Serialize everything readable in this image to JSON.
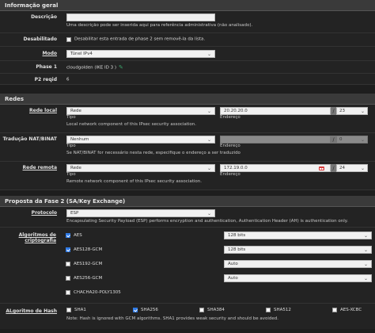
{
  "general": {
    "title": "Informação geral",
    "descricao_label": "Descrição",
    "descricao_value": "",
    "descricao_help": "Uma descrição pode ser inserida aqui para referência administrativa (não analisado).",
    "desabilitado_label": "Desabilitado",
    "desabilitado_text": "Desabilitar esta entrada de phase 2 sem removê-la da lista.",
    "modo_label": "Modo",
    "modo_value": "Túnel IPv4",
    "phase1_label": "Phase 1",
    "phase1_value": "cloudgolden (IKE ID 3 )",
    "p2reqid_label": "P2 reqid",
    "p2reqid_value": "6"
  },
  "networks": {
    "title": "Redes",
    "rede_local_label": "Rede local",
    "rede_local_tipo": "Rede",
    "rede_local_tipo_caption": "Tipo",
    "rede_local_addr": "20.20.20.0",
    "rede_local_mask": "23",
    "rede_local_addr_caption": "Endereço",
    "rede_local_help": "Local network component of this IPsec security association.",
    "nat_label": "Tradução NAT/BINAT",
    "nat_tipo": "Nenhum",
    "nat_tipo_caption": "Tipo",
    "nat_addr": "",
    "nat_mask": "0",
    "nat_addr_caption": "Endereço",
    "nat_help": "Se NAT/BINAT for necessário nesta rede, especifique o endereço a ser traduzido",
    "rede_remota_label": "Rede remota",
    "rede_remota_tipo": "Rede",
    "rede_remota_tipo_caption": "Tipo",
    "rede_remota_addr": "172.19.0.0",
    "rede_remota_mask": "24",
    "rede_remota_addr_caption": "Endereço",
    "rede_remota_help": "Remote network component of this IPsec security association.",
    "slash": "/"
  },
  "phase2": {
    "title": "Proposta da Fase 2 (SA/Key Exchange)",
    "protocolo_label": "Protocolo",
    "protocolo_value": "ESP",
    "protocolo_help": "Encapsulating Security Payload (ESP) performs encryption and authentication, Authentication Header (AH) is authentication only.",
    "alg_label_1": "Algoritmos de",
    "alg_label_2": "criptografia",
    "alg": [
      {
        "name": "AES",
        "bits": "128 bits"
      },
      {
        "name": "AES128-GCM",
        "bits": "128 bits"
      },
      {
        "name": "AES192-GCM",
        "bits": "Auto"
      },
      {
        "name": "AES256-GCM",
        "bits": "Auto"
      },
      {
        "name": "CHACHA20-POLY1305",
        "bits": ""
      }
    ],
    "hash_label": "ALgoritmo de Hash",
    "hashes": [
      "SHA1",
      "SHA256",
      "SHA384",
      "SHA512",
      "AES-XCBC"
    ],
    "hash_help": "Note: Hash is ignored with GCM algorithms. SHA1 provides weak security and should be avoided."
  },
  "icons": {
    "edit": "pencil-icon",
    "random": "rand-badge"
  },
  "colors": {
    "checkbox_on": "#2f7ae5",
    "badge": "#d83a3a"
  }
}
